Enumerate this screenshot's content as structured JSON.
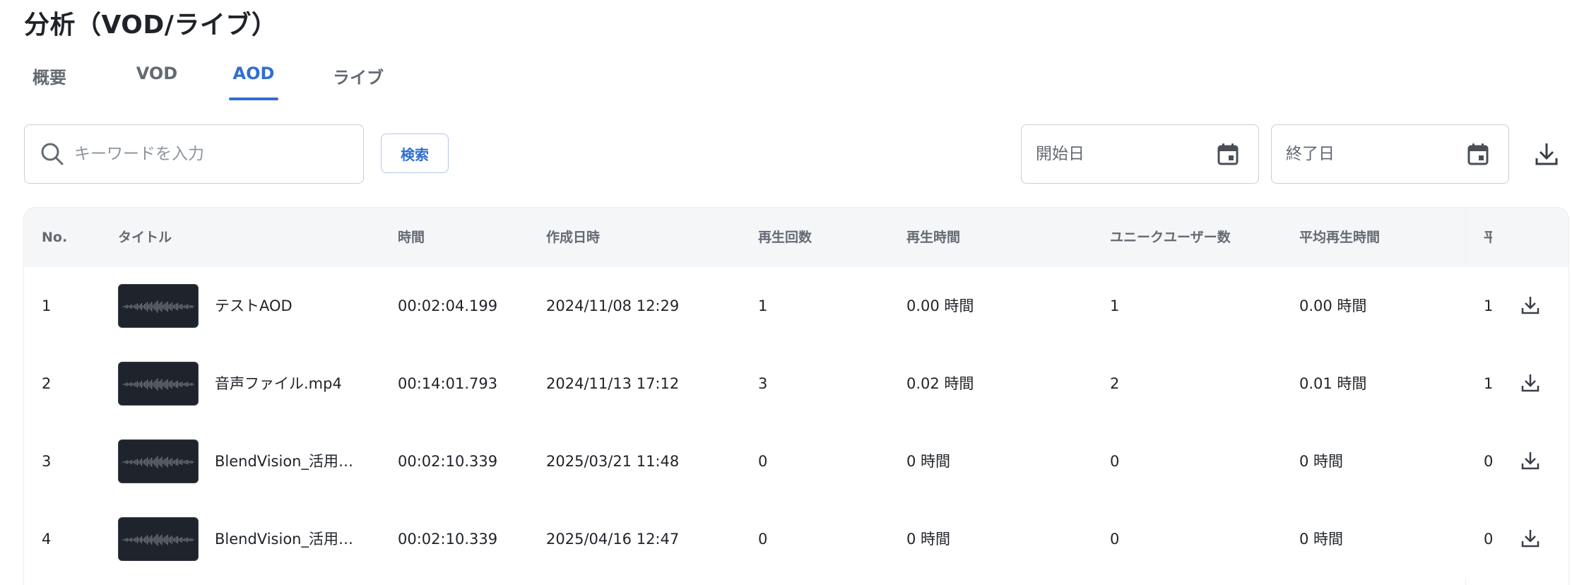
{
  "page": {
    "title": "分析（VOD/ライブ）"
  },
  "tabs": [
    {
      "label": "概要",
      "active": false
    },
    {
      "label": "VOD",
      "active": false
    },
    {
      "label": "AOD",
      "active": true
    },
    {
      "label": "ライブ",
      "active": false
    }
  ],
  "search": {
    "placeholder": "キーワードを入力",
    "value": "",
    "button_label": "検索",
    "icon": "search-icon"
  },
  "date_filter": {
    "start": {
      "placeholder": "開始日",
      "value": "",
      "icon": "calendar-icon"
    },
    "end": {
      "placeholder": "終了日",
      "value": "",
      "icon": "calendar-icon"
    }
  },
  "toolbar": {
    "download_icon": "download-icon"
  },
  "colors": {
    "accent": "#2f6fd1",
    "header_bg": "#f4f6f8",
    "muted_text": "#646a73",
    "thumbnail_bg": "#1f242c"
  },
  "table": {
    "columns": [
      "No.",
      "タイトル",
      "時間",
      "作成日時",
      "再生回数",
      "再生時間",
      "ユニークユーザー数",
      "平均再生時間",
      "平"
    ],
    "rows": [
      {
        "no": "1",
        "title": "テストAOD",
        "duration": "00:02:04.199",
        "created": "2024/11/08 12:29",
        "plays": "1",
        "play_time": "0.00 時間",
        "unique_users": "1",
        "avg_play_time": "0.00 時間",
        "partial": "1"
      },
      {
        "no": "2",
        "title": "音声ファイル.mp4",
        "duration": "00:14:01.793",
        "created": "2024/11/13 17:12",
        "plays": "3",
        "play_time": "0.02 時間",
        "unique_users": "2",
        "avg_play_time": "0.01 時間",
        "partial": "1"
      },
      {
        "no": "3",
        "title": "BlendVision_活用…",
        "duration": "00:02:10.339",
        "created": "2025/03/21 11:48",
        "plays": "0",
        "play_time": "0 時間",
        "unique_users": "0",
        "avg_play_time": "0 時間",
        "partial": "0"
      },
      {
        "no": "4",
        "title": "BlendVision_活用…",
        "duration": "00:02:10.339",
        "created": "2025/04/16 12:47",
        "plays": "0",
        "play_time": "0 時間",
        "unique_users": "0",
        "avg_play_time": "0 時間",
        "partial": "0"
      }
    ]
  }
}
